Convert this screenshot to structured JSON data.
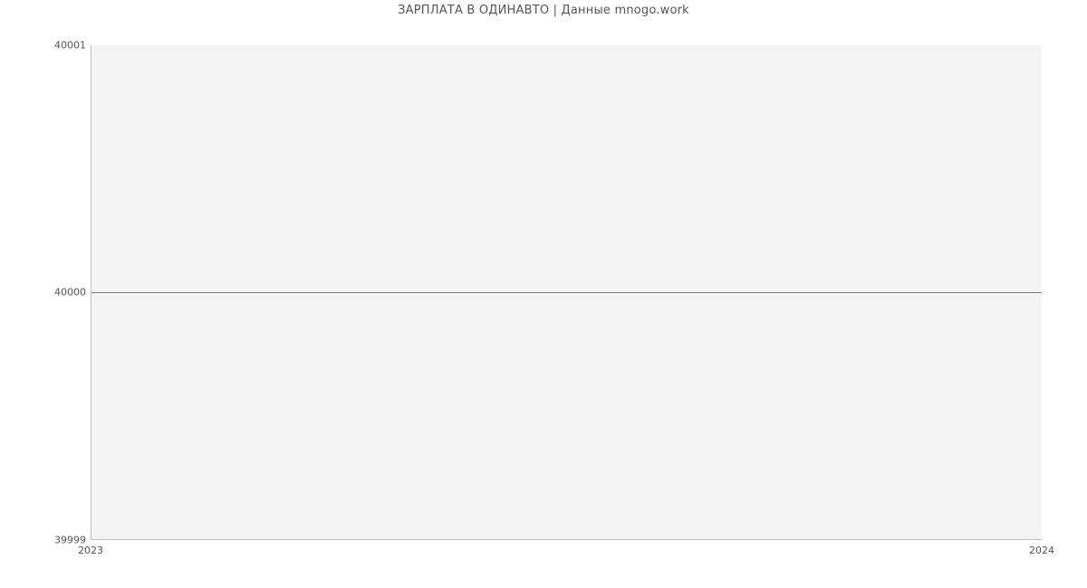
{
  "chart_data": {
    "type": "line",
    "title": "ЗАРПЛАТА В  ОДИНАВТО | Данные mnogo.work",
    "x": [
      "2023",
      "2024"
    ],
    "values": [
      40000,
      40000
    ],
    "xlabel": "",
    "ylabel": "",
    "xlim": [
      "2023",
      "2024"
    ],
    "ylim": [
      39999,
      40001
    ],
    "y_ticks": [
      39999,
      40000,
      40001
    ],
    "x_ticks": [
      "2023",
      "2024"
    ],
    "line_color": "#4a7fe0"
  }
}
